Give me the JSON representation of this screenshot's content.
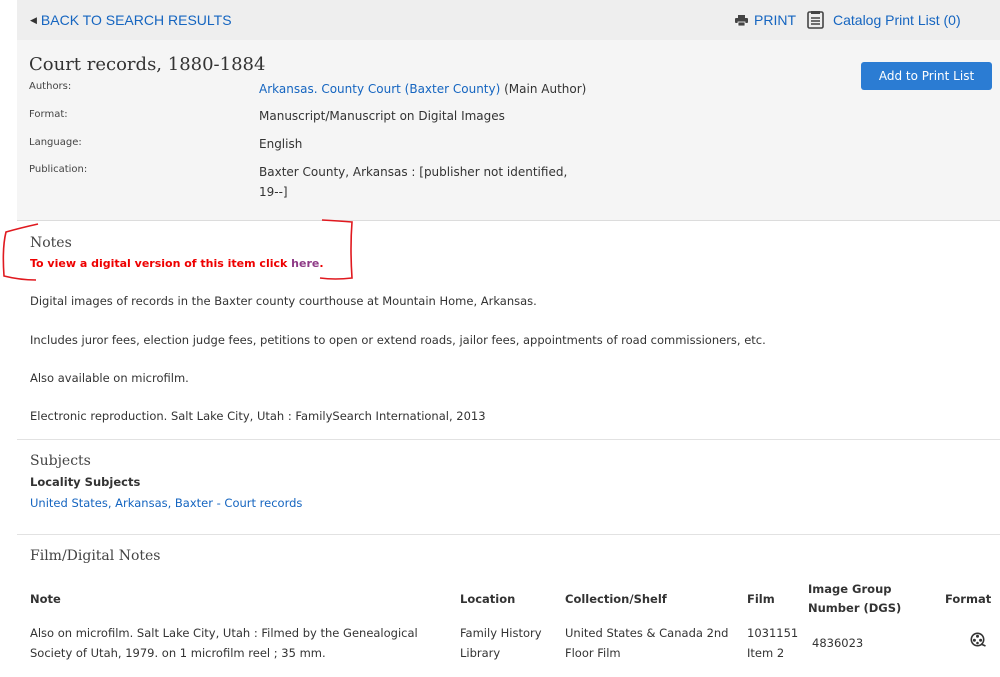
{
  "topbar": {
    "back_label": "BACK TO SEARCH RESULTS",
    "print_label": "PRINT",
    "catalog_print_list_label": "Catalog Print List (0)"
  },
  "record": {
    "title": "Court records, 1880-1884",
    "add_button_label": "Add to Print List",
    "authors_label": "Authors:",
    "author_link": "Arkansas. County Court (Baxter County)",
    "author_role": "(Main Author)",
    "format_label": "Format:",
    "format_value": "Manuscript/Manuscript on Digital Images",
    "language_label": "Language:",
    "language_value": "English",
    "publication_label": "Publication:",
    "publication_line1": "Baxter County, Arkansas : [publisher not identified,",
    "publication_line2": "19--]"
  },
  "notes": {
    "title": "Notes",
    "digital_prefix": "To view a digital version of this item click ",
    "digital_link": "here",
    "digital_suffix": ".",
    "paragraphs": [
      "Digital images of records in the Baxter county courthouse at Mountain Home, Arkansas.",
      "Includes juror fees, election judge fees, petitions to open or extend roads, jailor fees, appointments of road commissioners, etc.",
      "Also available on microfilm.",
      "Electronic reproduction. Salt Lake City, Utah : FamilySearch International, 2013"
    ]
  },
  "subjects": {
    "title": "Subjects",
    "heading": "Locality Subjects",
    "link": "United States, Arkansas, Baxter - Court records"
  },
  "film_notes": {
    "title": "Film/Digital Notes",
    "columns": {
      "note": "Note",
      "location": "Location",
      "collection": "Collection/Shelf",
      "film": "Film",
      "dgs_line1": "Image Group",
      "dgs_line2": "Number (DGS)",
      "format": "Format"
    },
    "rows": [
      {
        "note_line1": "Also on microfilm. Salt Lake City, Utah : Filmed by the Genealogical",
        "note_line2": "Society of Utah, 1979. on 1 microfilm reel ; 35 mm.",
        "location_line1": "Family History",
        "location_line2": "Library",
        "collection_line1": "United States & Canada 2nd",
        "collection_line2": "Floor Film",
        "film_line1": "1031151",
        "film_line2": "Item 2",
        "dgs": "4836023",
        "format_icon": "film-reel-icon"
      }
    ]
  },
  "colors": {
    "link": "#1565c0",
    "button": "#2b7cd3",
    "alert": "#ee0000",
    "visited_link": "#8e3a86"
  }
}
